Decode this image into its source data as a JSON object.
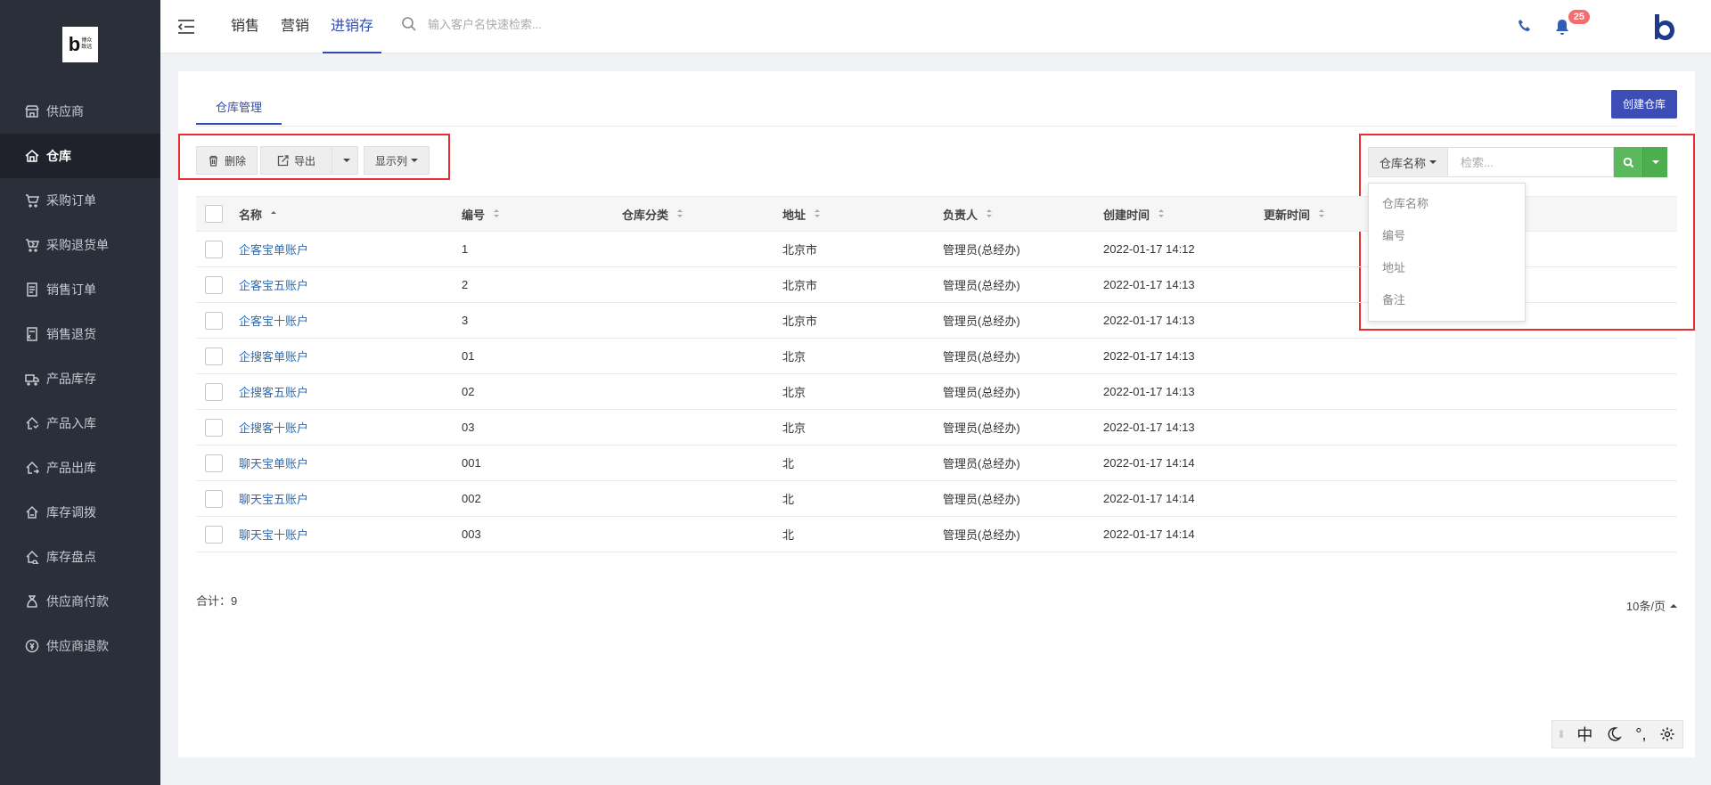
{
  "logo": {
    "mark": "b",
    "text_line1": "博众",
    "text_line2": "致远"
  },
  "sidebar": {
    "items": [
      {
        "label": "供应商",
        "icon": "store-icon",
        "active": false
      },
      {
        "label": "仓库",
        "icon": "home-icon",
        "active": true
      },
      {
        "label": "采购订单",
        "icon": "cart-icon",
        "active": false
      },
      {
        "label": "采购退货单",
        "icon": "cart-return-icon",
        "active": false
      },
      {
        "label": "销售订单",
        "icon": "document-icon",
        "active": false
      },
      {
        "label": "销售退货",
        "icon": "document-return-icon",
        "active": false
      },
      {
        "label": "产品库存",
        "icon": "truck-icon",
        "active": false
      },
      {
        "label": "产品入库",
        "icon": "inbound-icon",
        "active": false
      },
      {
        "label": "产品出库",
        "icon": "outbound-icon",
        "active": false
      },
      {
        "label": "库存调拨",
        "icon": "transfer-icon",
        "active": false
      },
      {
        "label": "库存盘点",
        "icon": "inventory-check-icon",
        "active": false
      },
      {
        "label": "供应商付款",
        "icon": "money-bag-icon",
        "active": false
      },
      {
        "label": "供应商退款",
        "icon": "refund-icon",
        "active": false
      }
    ]
  },
  "header": {
    "tabs": [
      {
        "label": "销售",
        "active": false
      },
      {
        "label": "营销",
        "active": false
      },
      {
        "label": "进销存",
        "active": true
      }
    ],
    "search_placeholder": "输入客户名快速检索...",
    "notification_count": "25"
  },
  "page": {
    "tab_label": "仓库管理",
    "create_button": "创建仓库",
    "toolbar": {
      "delete_label": "删除",
      "export_label": "导出",
      "columns_label": "显示列"
    },
    "search": {
      "field_selected": "仓库名称",
      "placeholder": "检索...",
      "field_options": [
        "仓库名称",
        "编号",
        "地址",
        "备注"
      ]
    },
    "table": {
      "columns": [
        "名称",
        "编号",
        "仓库分类",
        "地址",
        "负责人",
        "创建时间",
        "更新时间"
      ],
      "rows": [
        {
          "name": "企客宝单账户",
          "code": "1",
          "category": "",
          "address": "北京市",
          "owner": "管理员(总经办)",
          "created": "2022-01-17 14:12",
          "updated": ""
        },
        {
          "name": "企客宝五账户",
          "code": "2",
          "category": "",
          "address": "北京市",
          "owner": "管理员(总经办)",
          "created": "2022-01-17 14:13",
          "updated": ""
        },
        {
          "name": "企客宝十账户",
          "code": "3",
          "category": "",
          "address": "北京市",
          "owner": "管理员(总经办)",
          "created": "2022-01-17 14:13",
          "updated": ""
        },
        {
          "name": "企搜客单账户",
          "code": "01",
          "category": "",
          "address": "北京",
          "owner": "管理员(总经办)",
          "created": "2022-01-17 14:13",
          "updated": ""
        },
        {
          "name": "企搜客五账户",
          "code": "02",
          "category": "",
          "address": "北京",
          "owner": "管理员(总经办)",
          "created": "2022-01-17 14:13",
          "updated": ""
        },
        {
          "name": "企搜客十账户",
          "code": "03",
          "category": "",
          "address": "北京",
          "owner": "管理员(总经办)",
          "created": "2022-01-17 14:13",
          "updated": ""
        },
        {
          "name": "聊天宝单账户",
          "code": "001",
          "category": "",
          "address": "北",
          "owner": "管理员(总经办)",
          "created": "2022-01-17 14:14",
          "updated": ""
        },
        {
          "name": "聊天宝五账户",
          "code": "002",
          "category": "",
          "address": "北",
          "owner": "管理员(总经办)",
          "created": "2022-01-17 14:14",
          "updated": ""
        },
        {
          "name": "聊天宝十账户",
          "code": "003",
          "category": "",
          "address": "北",
          "owner": "管理员(总经办)",
          "created": "2022-01-17 14:14",
          "updated": ""
        }
      ]
    },
    "total_label": "合计：9",
    "page_size_label": "10条/页"
  },
  "ime": {
    "mode": "中",
    "punct": "°,"
  },
  "colors": {
    "accent": "#2f4cb0",
    "sidebar_bg": "#2b2f3a",
    "search_button": "#5cb85c",
    "highlight_border": "#e52e2e"
  }
}
